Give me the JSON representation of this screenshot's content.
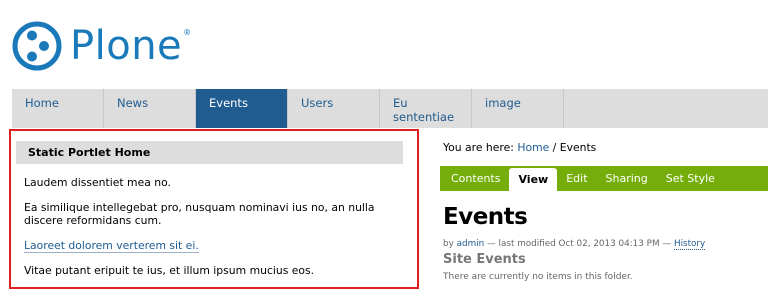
{
  "logo": {
    "text": "Plone",
    "registered": "®",
    "color": "#1a7ab9"
  },
  "nav": {
    "items": [
      {
        "label": "Home"
      },
      {
        "label": "News"
      },
      {
        "label": "Events"
      },
      {
        "label": "Users"
      },
      {
        "label": "Eu sententiae"
      },
      {
        "label": "image"
      }
    ],
    "active": "Events"
  },
  "portlet": {
    "header": "Static Portlet Home",
    "paragraph1": "Laudem dissentiet mea no.",
    "paragraph2": "Ea similique intellegebat pro, nusquam nominavi ius no, an nulla discere reformidans cum.",
    "link": "Laoreet dolorem verterem sit ei.",
    "paragraph3": "Vitae putant eripuit te ius, et illum ipsum mucius eos."
  },
  "breadcrumbs": {
    "prefix": "You are here:",
    "home": "Home",
    "separator": "/",
    "current": "Events"
  },
  "tabs": {
    "items": [
      {
        "label": "Contents"
      },
      {
        "label": "View"
      },
      {
        "label": "Edit"
      },
      {
        "label": "Sharing"
      },
      {
        "label": "Set Style"
      }
    ],
    "active": "View"
  },
  "content": {
    "title": "Events",
    "byline_by": "by",
    "author": "admin",
    "byline_modified": "— last modified Oct 02, 2013 04:13 PM —",
    "history": "History",
    "subheading": "Site Events",
    "empty_message": "There are currently no items in this folder."
  },
  "colors": {
    "brand": "#1a7ab9",
    "nav_active": "#205c90",
    "tab_bar": "#75ad0a",
    "highlight_border": "#e02020"
  }
}
